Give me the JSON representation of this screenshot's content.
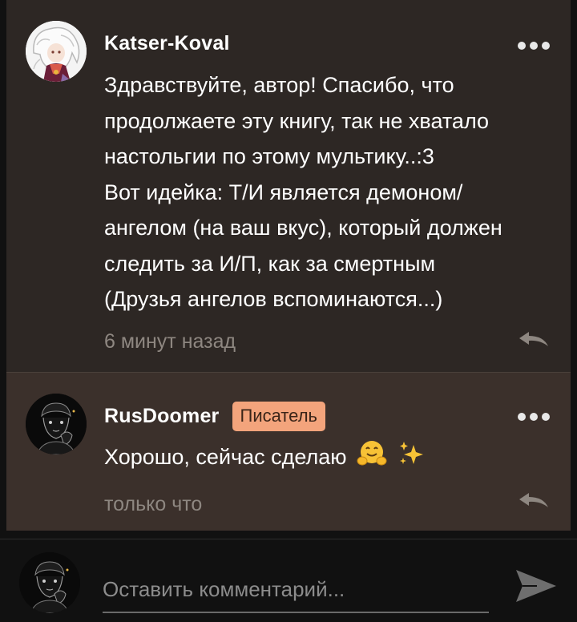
{
  "comments": [
    {
      "author": "Katser-Koval",
      "text_lines": [
        "Здравствуйте, автор! Спасибо, что",
        "продолжаете эту книгу, так не хватало",
        "настольгии по этому мультику..:3",
        "Вот идейка: Т/И является демоном/",
        "ангелом (на ваш вкус), который должен",
        "следить за И/П, как за смертным",
        "(Друзья ангелов вспоминаются...)"
      ],
      "time": "6 минут назад",
      "avatar_icon": "anime-girl-avatar-icon"
    },
    {
      "author": "RusDoomer",
      "badge": "Писатель",
      "text": "Хорошо, сейчас сделаю",
      "emojis": [
        "hugging-face-emoji",
        "sparkles-emoji"
      ],
      "time": "только что",
      "avatar_icon": "dark-sketch-avatar-icon"
    }
  ],
  "composer": {
    "placeholder": "Оставить комментарий...",
    "avatar_icon": "dark-sketch-avatar-icon",
    "send_icon": "send-arrow-icon"
  },
  "colors": {
    "background": "#111111",
    "comment_bg": "#2d2724",
    "comment_bg_highlight": "#3b302b",
    "badge_bg": "#f3a47c",
    "muted_text": "#8e8781"
  }
}
